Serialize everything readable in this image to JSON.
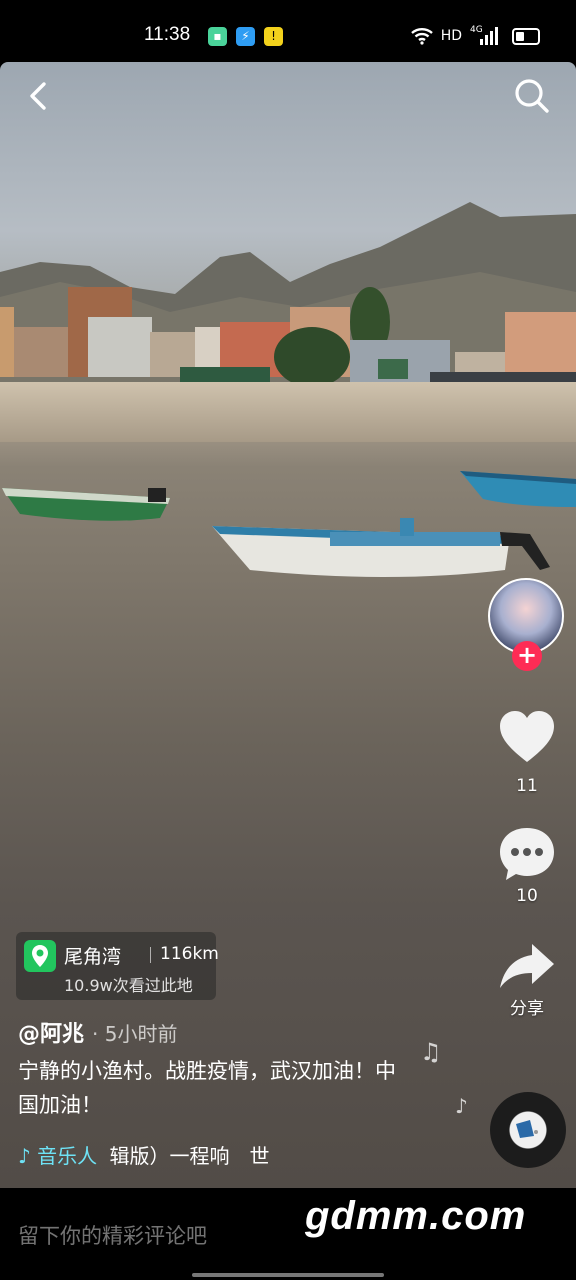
{
  "status_bar": {
    "time": "11:38",
    "network": "HD",
    "signal": "4G"
  },
  "location": {
    "name": "尾角湾",
    "distance": "116km",
    "views": "10.9w次看过此地"
  },
  "post": {
    "author": "@阿兆",
    "time_ago": "· 5小时前",
    "description": "宁静的小渔村。战胜疫情，武汉加油！中国加油！"
  },
  "music": {
    "author": "音乐人",
    "track": "辑版）一程响　世"
  },
  "actions": {
    "likes": "11",
    "comments": "10",
    "share": "分享"
  },
  "comment_bar": {
    "placeholder": "留下你的精彩评论吧"
  },
  "watermark": "gdmm.com",
  "colors": {
    "follow_red": "#fe2c55",
    "location_green": "#22c55e",
    "music_cyan": "#6ee2f5"
  }
}
